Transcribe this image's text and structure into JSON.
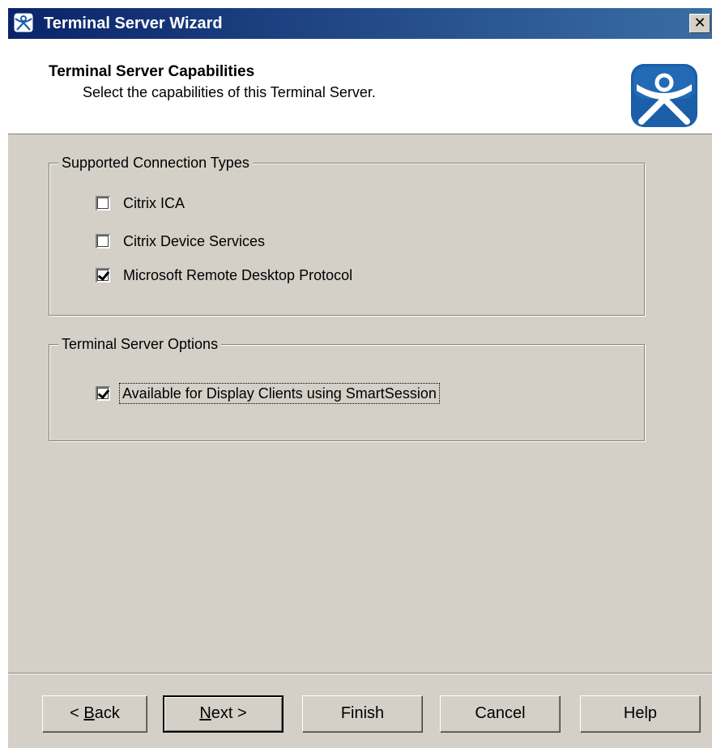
{
  "window": {
    "title": "Terminal Server Wizard",
    "close_label": "✕"
  },
  "header": {
    "title": "Terminal Server Capabilities",
    "subtitle": "Select the capabilities of this Terminal Server.",
    "logo_icon": "thinmanager-logo-icon"
  },
  "connection_types": {
    "legend": "Supported Connection Types",
    "items": [
      {
        "label": "Citrix ICA",
        "checked": false
      },
      {
        "label": "Citrix Device Services",
        "checked": false
      },
      {
        "label": "Microsoft Remote Desktop Protocol",
        "checked": true
      }
    ]
  },
  "server_options": {
    "legend": "Terminal Server Options",
    "items": [
      {
        "label": "Available for Display Clients using SmartSession",
        "checked": true,
        "focused": true
      }
    ]
  },
  "buttons": {
    "back": {
      "prefix": "< ",
      "mnemonic": "B",
      "rest": "ack"
    },
    "next": {
      "mnemonic": "N",
      "rest": "ext >"
    },
    "finish": "Finish",
    "cancel": "Cancel",
    "help": "Help"
  },
  "colors": {
    "dialog_bg": "#d4d0c8",
    "titlebar_start": "#0a246a",
    "titlebar_end": "#3a6ea5",
    "logo_blue": "#1b5fa8"
  }
}
